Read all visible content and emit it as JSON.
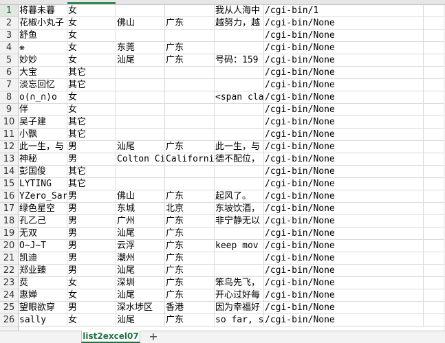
{
  "sheet": {
    "tab_name": "list2excel07",
    "add_sheet_symbol": "+",
    "selected_row": 1,
    "rows": [
      [
        "将暮未暮",
        "女",
        "",
        "",
        "我从人海中",
        "/cgi-bin/1",
        ""
      ],
      [
        "花椒小丸子",
        "女",
        "佛山",
        "广东",
        "越努力，越",
        "/cgi-bin/None",
        ""
      ],
      [
        "舒鱼",
        "女",
        "",
        "",
        "",
        "/cgi-bin/None",
        ""
      ],
      [
        "❋",
        "女",
        "东莞",
        "广东",
        "",
        "/cgi-bin/None",
        ""
      ],
      [
        "妙妙",
        "女",
        "汕尾",
        "广东",
        "号码：159",
        "/cgi-bin/None",
        ""
      ],
      [
        "大宝",
        "其它",
        "",
        "",
        "",
        "/cgi-bin/None",
        ""
      ],
      [
        "淡忘回忆",
        "其它",
        "",
        "",
        "",
        "/cgi-bin/None",
        ""
      ],
      [
        "o(∩_∩)o",
        "女",
        "",
        "",
        "<span cla",
        "/cgi-bin/None",
        ""
      ],
      [
        "伴",
        "女",
        "",
        "",
        "",
        "/cgi-bin/None",
        ""
      ],
      [
        "吴子建",
        "其它",
        "",
        "",
        "",
        "/cgi-bin/None",
        ""
      ],
      [
        "小飘",
        "其它",
        "",
        "",
        "",
        "/cgi-bin/None",
        ""
      ],
      [
        "此一生，与",
        "男",
        "汕尾",
        "广东",
        "此一生，与",
        "/cgi-bin/None",
        ""
      ],
      [
        "神秘",
        "男",
        "Colton Ci",
        "Californi",
        "德不配位，",
        "/cgi-bin/None",
        ""
      ],
      [
        "彭国俊",
        "其它",
        "",
        "",
        "",
        "/cgi-bin/None",
        ""
      ],
      [
        "LYTING",
        "其它",
        "",
        "",
        "",
        "/cgi-bin/None",
        ""
      ],
      [
        "YZero_Sar",
        "男",
        "佛山",
        "广东",
        "起风了。",
        "/cgi-bin/None",
        ""
      ],
      [
        "绿色星空",
        "男",
        "东城",
        "北京",
        "东坡饮酒，",
        "/cgi-bin/None",
        ""
      ],
      [
        "孔乙己",
        "男",
        "广州",
        "广东",
        "非宁静无以",
        "/cgi-bin/None",
        ""
      ],
      [
        "无双",
        "男",
        "汕尾",
        "广东",
        "",
        "/cgi-bin/None",
        ""
      ],
      [
        "O~J~T",
        "男",
        "云浮",
        "广东",
        "keep  mov",
        "/cgi-bin/None",
        ""
      ],
      [
        "凯迪",
        "男",
        "潮州",
        "广东",
        "",
        "/cgi-bin/None",
        ""
      ],
      [
        "郑业臻",
        "男",
        "汕尾",
        "广东",
        "",
        "/cgi-bin/None",
        ""
      ],
      [
        "烎",
        "女",
        "深圳",
        "广东",
        "笨鸟先飞，",
        "/cgi-bin/None",
        ""
      ],
      [
        "惠婵",
        "女",
        "汕尾",
        "广东",
        "开心过好每",
        "/cgi-bin/None",
        ""
      ],
      [
        "望眼欲穿",
        "男",
        "深水埗区",
        "香港",
        "因为幸福好",
        "/cgi-bin/None",
        ""
      ],
      [
        "sally",
        "女",
        "汕尾",
        "广东",
        "so far, s",
        "/cgi-bin/None",
        ""
      ]
    ],
    "row_numbers": [
      "1",
      "2",
      "3",
      "4",
      "5",
      "6",
      "7",
      "8",
      "9",
      "10",
      "11",
      "12",
      "13",
      "14",
      "15",
      "16",
      "17",
      "18",
      "19",
      "20",
      "21",
      "22",
      "23",
      "24",
      "25",
      "26"
    ]
  },
  "colors": {
    "accent": "#217346",
    "gridline": "#dadada"
  }
}
